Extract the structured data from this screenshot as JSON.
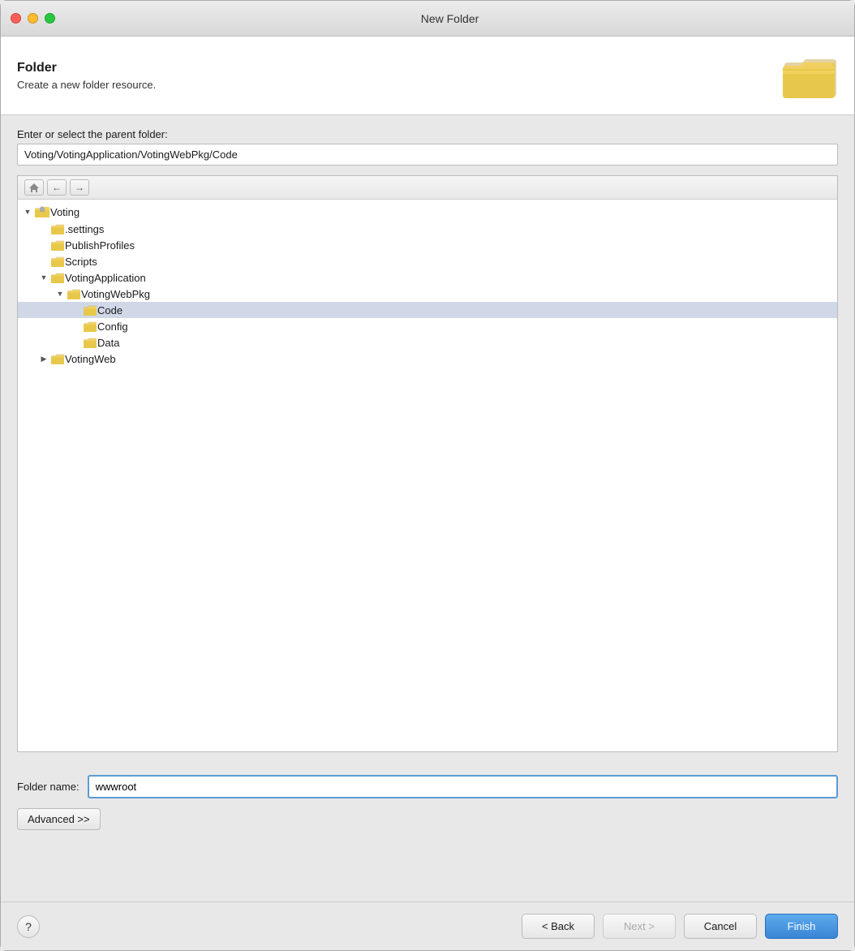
{
  "titleBar": {
    "title": "New Folder"
  },
  "header": {
    "title": "Folder",
    "subtitle": "Create a new folder resource."
  },
  "form": {
    "parentFolderLabel": "Enter or select the parent folder:",
    "parentFolderValue": "Voting/VotingApplication/VotingWebPkg/Code",
    "folderNameLabel": "Folder name:",
    "folderNameValue": "wwwroot",
    "advancedButtonLabel": "Advanced >>"
  },
  "tree": {
    "items": [
      {
        "id": "voting",
        "label": "Voting",
        "level": 0,
        "expanded": true,
        "hasToggle": true,
        "isRoot": true
      },
      {
        "id": "settings",
        "label": ".settings",
        "level": 1,
        "expanded": false,
        "hasToggle": false
      },
      {
        "id": "publishprofiles",
        "label": "PublishProfiles",
        "level": 1,
        "expanded": false,
        "hasToggle": false
      },
      {
        "id": "scripts",
        "label": "Scripts",
        "level": 1,
        "expanded": false,
        "hasToggle": false
      },
      {
        "id": "votingapplication",
        "label": "VotingApplication",
        "level": 1,
        "expanded": true,
        "hasToggle": true
      },
      {
        "id": "votingwebpkg",
        "label": "VotingWebPkg",
        "level": 2,
        "expanded": true,
        "hasToggle": true
      },
      {
        "id": "code",
        "label": "Code",
        "level": 3,
        "expanded": false,
        "hasToggle": false,
        "selected": true
      },
      {
        "id": "config",
        "label": "Config",
        "level": 3,
        "expanded": false,
        "hasToggle": false
      },
      {
        "id": "data",
        "label": "Data",
        "level": 3,
        "expanded": false,
        "hasToggle": false
      },
      {
        "id": "votingweb",
        "label": "VotingWeb",
        "level": 1,
        "expanded": false,
        "hasToggle": true
      }
    ]
  },
  "buttons": {
    "back": "< Back",
    "next": "Next >",
    "cancel": "Cancel",
    "finish": "Finish",
    "help": "?"
  }
}
